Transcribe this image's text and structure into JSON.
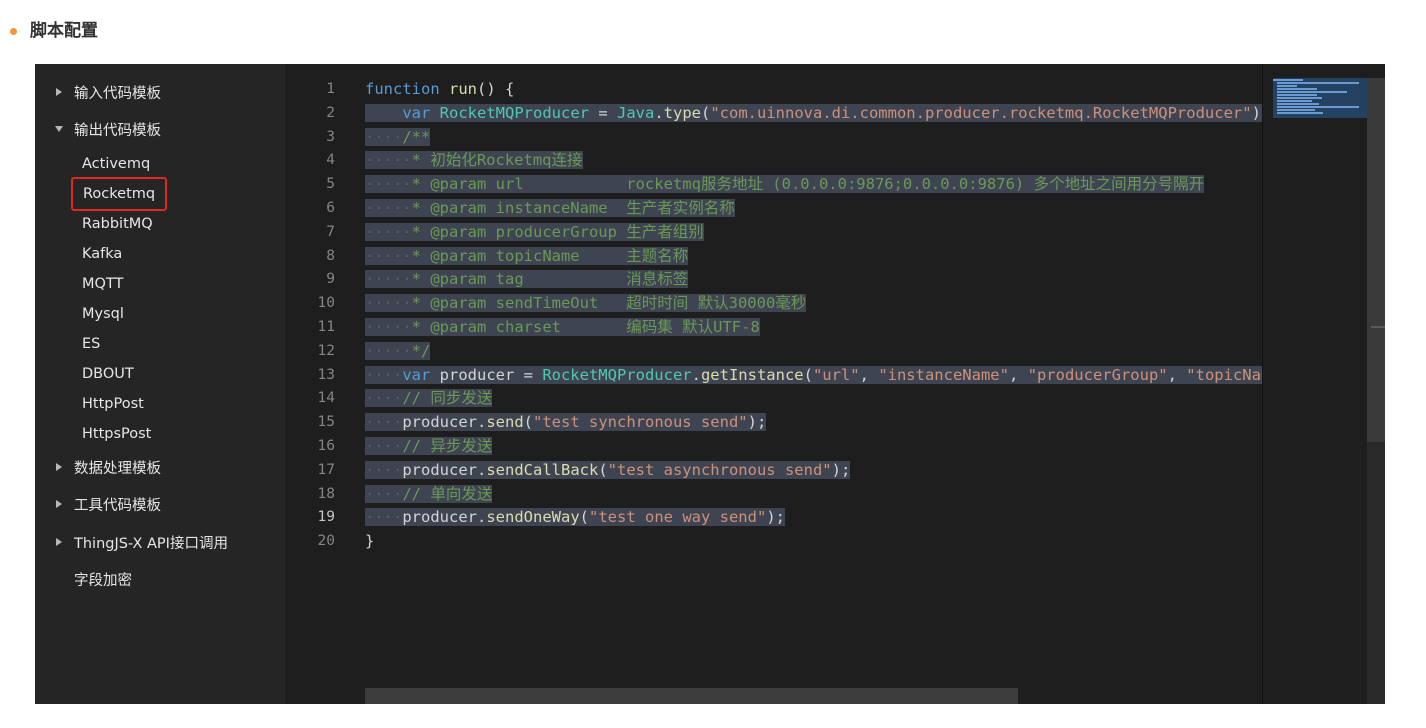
{
  "section": {
    "title": "脚本配置",
    "dot_color": "#f0963c"
  },
  "sidebar": {
    "groups": [
      {
        "label": "输入代码模板",
        "expanded": false
      },
      {
        "label": "输出代码模板",
        "expanded": true,
        "children": [
          "Activemq",
          "Rocketmq",
          "RabbitMQ",
          "Kafka",
          "MQTT",
          "Mysql",
          "ES",
          "DBOUT",
          "HttpPost",
          "HttpsPost"
        ],
        "selected": "Rocketmq"
      },
      {
        "label": "数据处理模板",
        "expanded": false
      },
      {
        "label": "工具代码模板",
        "expanded": false
      },
      {
        "label": "ThingJS-X API接口调用",
        "expanded": false
      },
      {
        "label": "字段加密",
        "expanded": false,
        "leaf": true
      }
    ]
  },
  "editor": {
    "current_line": 19,
    "line_numbers": [
      "1",
      "2",
      "3",
      "4",
      "5",
      "6",
      "7",
      "8",
      "9",
      "10",
      "11",
      "12",
      "13",
      "14",
      "15",
      "16",
      "17",
      "18",
      "19",
      "20"
    ],
    "lines": [
      {
        "n": 1,
        "sel": false,
        "tokens": [
          {
            "t": "kw",
            "v": "function"
          },
          {
            "t": "pl",
            "v": " "
          },
          {
            "t": "fn",
            "v": "run"
          },
          {
            "t": "pl",
            "v": "() {"
          }
        ]
      },
      {
        "n": 2,
        "sel": true,
        "tokens": [
          {
            "t": "ws",
            "v": "    "
          },
          {
            "t": "kw",
            "v": "var"
          },
          {
            "t": "pl",
            "v": " "
          },
          {
            "t": "ty",
            "v": "RocketMQProducer"
          },
          {
            "t": "pl",
            "v": " = "
          },
          {
            "t": "ty",
            "v": "Java"
          },
          {
            "t": "pl",
            "v": "."
          },
          {
            "t": "fn",
            "v": "type"
          },
          {
            "t": "pl",
            "v": "("
          },
          {
            "t": "str",
            "v": "\"com.uinnova.di.common.producer.rocketmq.RocketMQProducer\""
          },
          {
            "t": "pl",
            "v": ");"
          }
        ]
      },
      {
        "n": 3,
        "sel": true,
        "tokens": [
          {
            "t": "ws",
            "v": "····"
          },
          {
            "t": "cm",
            "v": "/**"
          }
        ]
      },
      {
        "n": 4,
        "sel": true,
        "tokens": [
          {
            "t": "ws",
            "v": "·····"
          },
          {
            "t": "cm",
            "v": "* 初始化Rocketmq连接"
          }
        ]
      },
      {
        "n": 5,
        "sel": true,
        "tokens": [
          {
            "t": "ws",
            "v": "·····"
          },
          {
            "t": "cm",
            "v": "* @param url           rocketmq服务地址 (0.0.0.0:9876;0.0.0.0:9876) 多个地址之间用分号隔开"
          }
        ]
      },
      {
        "n": 6,
        "sel": true,
        "tokens": [
          {
            "t": "ws",
            "v": "·····"
          },
          {
            "t": "cm",
            "v": "* @param instanceName  生产者实例名称"
          }
        ]
      },
      {
        "n": 7,
        "sel": true,
        "tokens": [
          {
            "t": "ws",
            "v": "·····"
          },
          {
            "t": "cm",
            "v": "* @param producerGroup 生产者组别"
          }
        ]
      },
      {
        "n": 8,
        "sel": true,
        "tokens": [
          {
            "t": "ws",
            "v": "·····"
          },
          {
            "t": "cm",
            "v": "* @param topicName     主题名称"
          }
        ]
      },
      {
        "n": 9,
        "sel": true,
        "tokens": [
          {
            "t": "ws",
            "v": "·····"
          },
          {
            "t": "cm",
            "v": "* @param tag           消息标签"
          }
        ]
      },
      {
        "n": 10,
        "sel": true,
        "tokens": [
          {
            "t": "ws",
            "v": "·····"
          },
          {
            "t": "cm",
            "v": "* @param sendTimeOut   超时时间 默认30000毫秒"
          }
        ]
      },
      {
        "n": 11,
        "sel": true,
        "tokens": [
          {
            "t": "ws",
            "v": "·····"
          },
          {
            "t": "cm",
            "v": "* @param charset       编码集 默认UTF-8"
          }
        ]
      },
      {
        "n": 12,
        "sel": true,
        "tokens": [
          {
            "t": "ws",
            "v": "·····"
          },
          {
            "t": "cm",
            "v": "*/"
          }
        ]
      },
      {
        "n": 13,
        "sel": true,
        "tokens": [
          {
            "t": "ws",
            "v": "····"
          },
          {
            "t": "kw",
            "v": "var"
          },
          {
            "t": "pl",
            "v": " producer = "
          },
          {
            "t": "ty",
            "v": "RocketMQProducer"
          },
          {
            "t": "pl",
            "v": "."
          },
          {
            "t": "fn",
            "v": "getInstance"
          },
          {
            "t": "pl",
            "v": "("
          },
          {
            "t": "str",
            "v": "\"url\""
          },
          {
            "t": "pl",
            "v": ", "
          },
          {
            "t": "str",
            "v": "\"instanceName\""
          },
          {
            "t": "pl",
            "v": ", "
          },
          {
            "t": "str",
            "v": "\"producerGroup\""
          },
          {
            "t": "pl",
            "v": ", "
          },
          {
            "t": "str",
            "v": "\"topicName\""
          },
          {
            "t": "pl",
            "v": ");"
          }
        ]
      },
      {
        "n": 14,
        "sel": true,
        "tokens": [
          {
            "t": "ws",
            "v": "····"
          },
          {
            "t": "cm",
            "v": "// 同步发送"
          }
        ]
      },
      {
        "n": 15,
        "sel": true,
        "tokens": [
          {
            "t": "ws",
            "v": "····"
          },
          {
            "t": "pl",
            "v": "producer."
          },
          {
            "t": "fn",
            "v": "send"
          },
          {
            "t": "pl",
            "v": "("
          },
          {
            "t": "str",
            "v": "\"test synchronous send\""
          },
          {
            "t": "pl",
            "v": ");"
          }
        ]
      },
      {
        "n": 16,
        "sel": true,
        "tokens": [
          {
            "t": "ws",
            "v": "····"
          },
          {
            "t": "cm",
            "v": "// 异步发送"
          }
        ]
      },
      {
        "n": 17,
        "sel": true,
        "tokens": [
          {
            "t": "ws",
            "v": "····"
          },
          {
            "t": "pl",
            "v": "producer."
          },
          {
            "t": "fn",
            "v": "sendCallBack"
          },
          {
            "t": "pl",
            "v": "("
          },
          {
            "t": "str",
            "v": "\"test asynchronous send\""
          },
          {
            "t": "pl",
            "v": ");"
          }
        ]
      },
      {
        "n": 18,
        "sel": true,
        "tokens": [
          {
            "t": "ws",
            "v": "····"
          },
          {
            "t": "cm",
            "v": "// 单向发送"
          }
        ]
      },
      {
        "n": 19,
        "sel": true,
        "tokens": [
          {
            "t": "ws",
            "v": "····"
          },
          {
            "t": "pl",
            "v": "producer."
          },
          {
            "t": "fn",
            "v": "sendOneWay"
          },
          {
            "t": "pl",
            "v": "("
          },
          {
            "t": "str",
            "v": "\"test one way send\""
          },
          {
            "t": "pl",
            "v": ");"
          }
        ]
      },
      {
        "n": 20,
        "sel": false,
        "tokens": [
          {
            "t": "pl",
            "v": "}"
          }
        ]
      }
    ]
  }
}
